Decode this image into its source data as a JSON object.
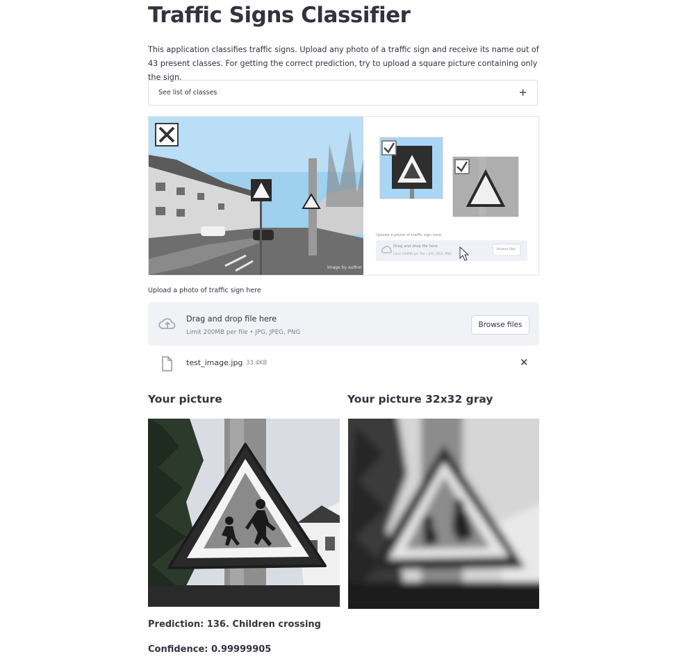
{
  "header": {
    "title": "Traffic Signs Classifier",
    "description": "This application classifies traffic signs. Upload any photo of a traffic sign and receive its name out of 43 present classes. For getting the correct prediction, try to upload a square picture containing only the sign."
  },
  "expander": {
    "label": "See list of classes",
    "icon": "plus-icon"
  },
  "demo_image": {
    "credit": "Image by author",
    "mini_uploader": {
      "label": "Upload a photo of traffic sign here",
      "drop_text": "Drag and drop file here",
      "limit_text": "Limit 200MB per file • JPG, JPEG, PNG",
      "browse_label": "Browse files"
    }
  },
  "uploader": {
    "label": "Upload a photo of traffic sign here",
    "drop_text": "Drag and drop file here",
    "limit_text": "Limit 200MB per file • JPG, JPEG, PNG",
    "browse_label": "Browse files",
    "icon": "cloud-upload-icon"
  },
  "uploaded_file": {
    "name": "test_image.jpg",
    "size": "33.4KB",
    "icon": "file-icon",
    "remove_icon": "close-icon"
  },
  "columns": [
    {
      "title": "Your picture"
    },
    {
      "title": "Your picture 32x32 gray"
    }
  ],
  "result": {
    "prediction": "Prediction: 136. Children crossing",
    "confidence": "Confidence: 0.99999905"
  },
  "colors": {
    "text": "#31333f",
    "dropzone_bg": "#f0f2f6",
    "muted": "#7f828d"
  }
}
